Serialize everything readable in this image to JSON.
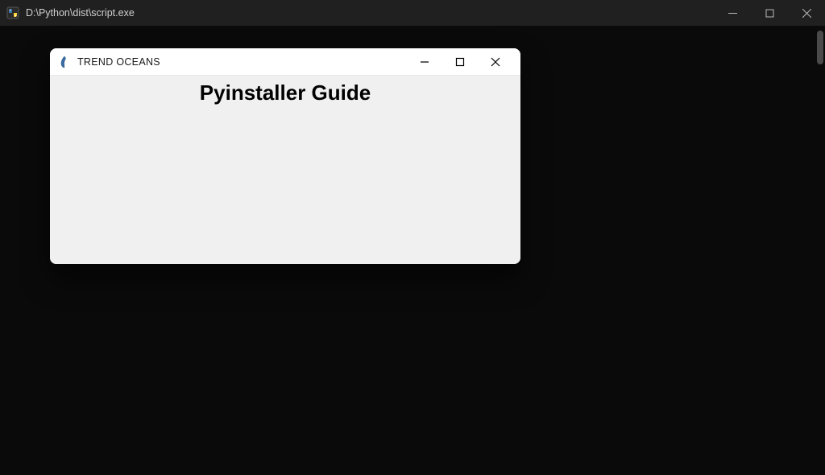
{
  "outerWindow": {
    "title": "D:\\Python\\dist\\script.exe",
    "icon": "app-icon"
  },
  "innerWindow": {
    "title": "TREND OCEANS",
    "icon": "tk-feather-icon",
    "heading": "Pyinstaller Guide"
  }
}
